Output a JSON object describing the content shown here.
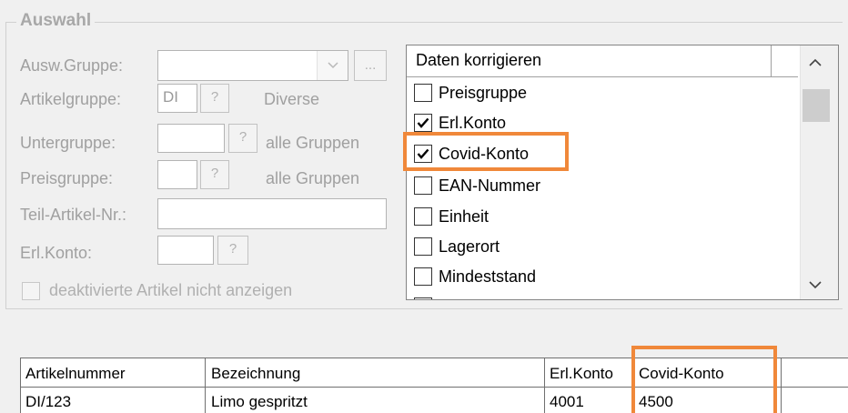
{
  "group": {
    "title": "Auswahl"
  },
  "filters": {
    "ausw_gruppe_label": "Ausw.Gruppe:",
    "ausw_gruppe_value": "",
    "ellipsis_label": "...",
    "artikelgruppe_label": "Artikelgruppe:",
    "artikelgruppe_value": "DI",
    "artikelgruppe_desc": "Diverse",
    "untergruppe_label": "Untergruppe:",
    "untergruppe_value": "",
    "untergruppe_desc": "alle Gruppen",
    "preisgruppe_label": "Preisgruppe:",
    "preisgruppe_value": "",
    "preisgruppe_desc": "alle Gruppen",
    "teil_artikel_label": "Teil-Artikel-Nr.:",
    "teil_artikel_value": "",
    "erl_konto_label": "Erl.Konto:",
    "erl_konto_value": "",
    "question_label": "?",
    "deactivated_label": "deaktivierte Artikel nicht anzeigen",
    "deactivated_checked": false
  },
  "checklist": {
    "header": "Daten korrigieren",
    "items": [
      {
        "label": "Preisgruppe",
        "checked": false
      },
      {
        "label": "Erl.Konto",
        "checked": true
      },
      {
        "label": "Covid-Konto",
        "checked": true,
        "highlighted": true
      },
      {
        "label": "EAN-Nummer",
        "checked": false
      },
      {
        "label": "Einheit",
        "checked": false
      },
      {
        "label": "Lagerort",
        "checked": false
      },
      {
        "label": "Mindeststand",
        "checked": false
      }
    ]
  },
  "grid": {
    "columns": [
      "Artikelnummer",
      "Bezeichnung",
      "Erl.Konto",
      "Covid-Konto"
    ],
    "rows": [
      [
        "DI/123",
        "Limo gespritzt",
        "4001",
        "4500"
      ]
    ]
  },
  "colors": {
    "highlight": "#f0883a"
  }
}
